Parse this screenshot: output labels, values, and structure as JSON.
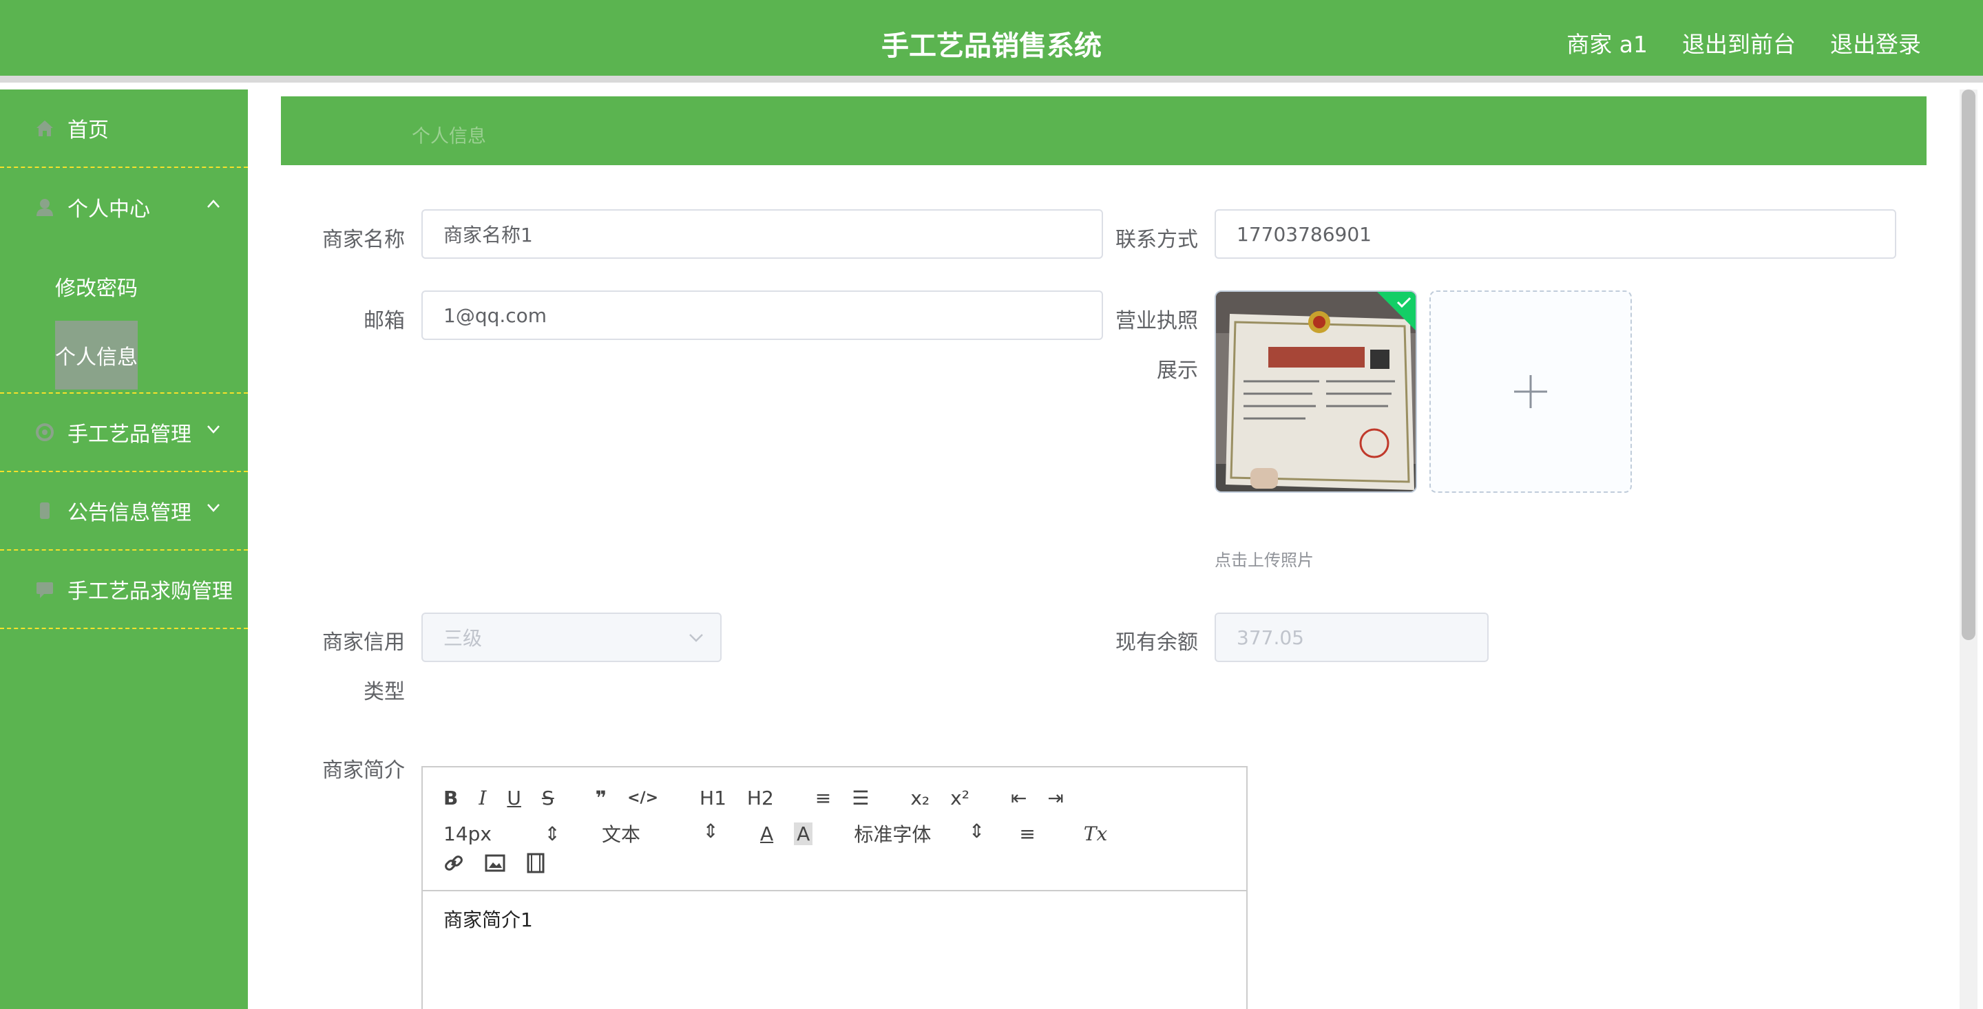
{
  "header": {
    "title": "手工艺品销售系统",
    "links": [
      "商家 a1",
      "退出到前台",
      "退出登录"
    ]
  },
  "sidebar": {
    "items": [
      {
        "label": "首页",
        "icon": "home-icon"
      },
      {
        "label": "个人中心",
        "icon": "user-icon",
        "expanded": true
      },
      {
        "label": "手工艺品管理",
        "icon": "settings-icon"
      },
      {
        "label": "公告信息管理",
        "icon": "notice-icon"
      },
      {
        "label": "手工艺品求购管理",
        "icon": "message-icon"
      }
    ],
    "subitems": [
      "修改密码",
      "个人信息"
    ],
    "active": "个人信息"
  },
  "breadcrumb": "个人信息",
  "form": {
    "merchant_name_label": "商家名称",
    "merchant_name_value": "商家名称1",
    "contact_label": "联系方式",
    "contact_value": "17703786901",
    "email_label": "邮箱",
    "email_value": "1@qq.com",
    "license_label_1": "营业执照",
    "license_label_2": "展示",
    "upload_tip": "点击上传照片",
    "credit_label_1": "商家信用",
    "credit_label_2": "类型",
    "credit_value": "三级",
    "balance_label": "现有余额",
    "balance_value": "377.05",
    "intro_label": "商家简介",
    "intro_content": "商家简介1"
  },
  "editor": {
    "font_size": "14px",
    "paragraph": "文本",
    "font_family": "标准字体",
    "row1": [
      "B",
      "I",
      "U",
      "S",
      "❞",
      "</>",
      "H1",
      "H2"
    ],
    "row1b": [
      "≡",
      "☰",
      "x₂",
      "x²",
      "⇤",
      "⇥"
    ]
  },
  "colors": {
    "primary_green": "#5bb450",
    "dashed_yellow": "#f5e12a",
    "active_bg": "#8aa38a",
    "check_green": "#13ce66"
  }
}
